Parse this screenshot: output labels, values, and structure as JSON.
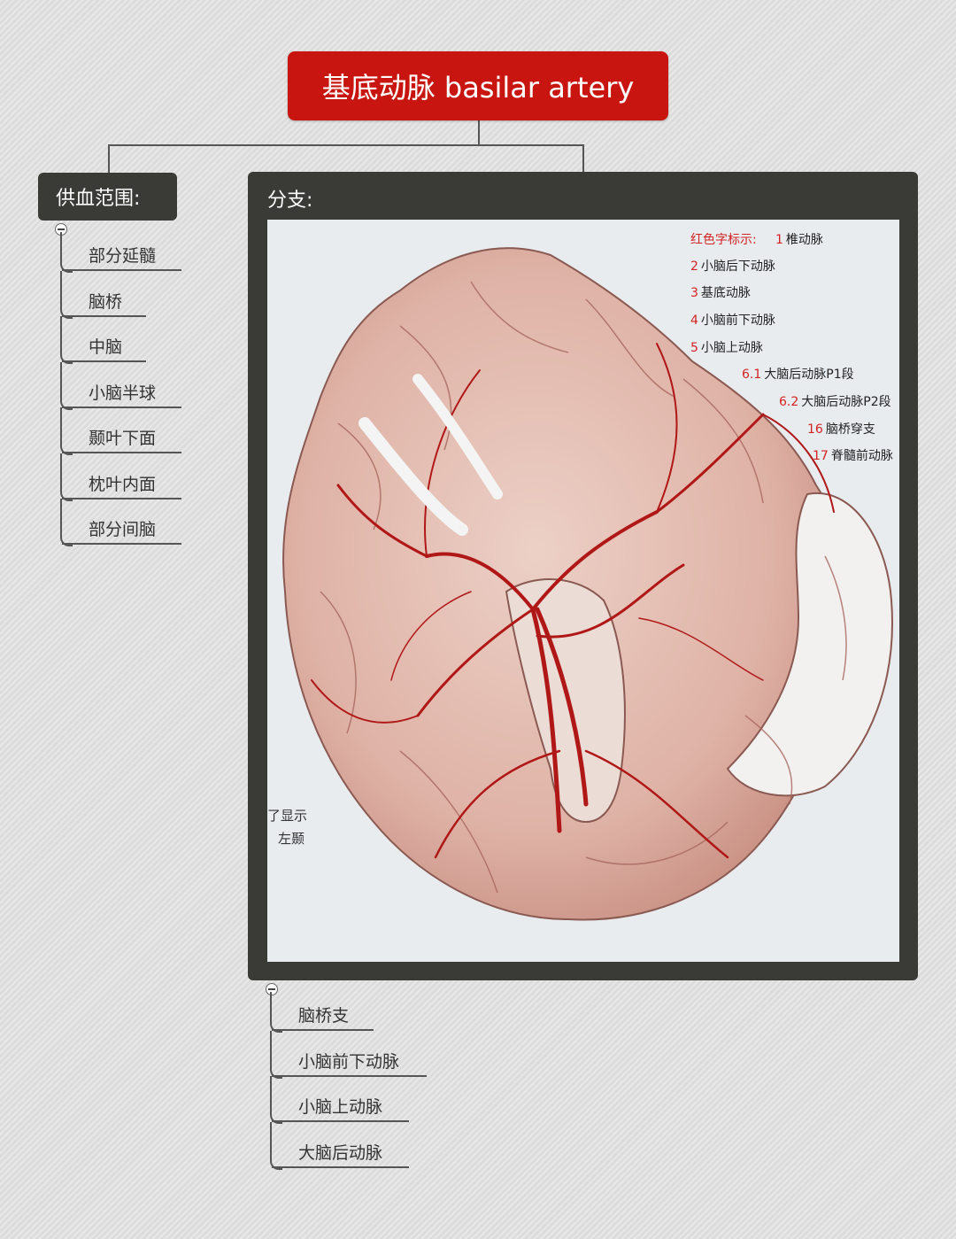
{
  "root": {
    "title": "基底动脉 basilar artery"
  },
  "supply": {
    "title": "供血范围:",
    "items": [
      "部分延髓",
      "脑桥",
      "中脑",
      "小脑半球",
      "颞叶下面",
      "枕叶内面",
      "部分间脑"
    ]
  },
  "branches": {
    "title": "分支:",
    "items": [
      "脑桥支",
      "小脑前下动脉",
      "小脑上动脉",
      "大脑后动脉"
    ]
  },
  "image": {
    "legend_header": "红色字标示:",
    "legend": [
      {
        "num": "1",
        "label": "椎动脉"
      },
      {
        "num": "2",
        "label": "小脑后下动脉"
      },
      {
        "num": "3",
        "label": "基底动脉"
      },
      {
        "num": "4",
        "label": "小脑前下动脉"
      },
      {
        "num": "5",
        "label": "小脑上动脉"
      },
      {
        "num": "6.1",
        "label": "大脑后动脉P1段"
      },
      {
        "num": "6.2",
        "label": "大脑后动脉P2段"
      },
      {
        "num": "16",
        "label": "脑桥穿支"
      },
      {
        "num": "17",
        "label": "脊髓前动脉"
      }
    ],
    "caption_line1": "了显示",
    "caption_line2": "左颞"
  },
  "colors": {
    "root": "#c91510",
    "topic": "#3a3a36",
    "artery": "#b01818"
  }
}
